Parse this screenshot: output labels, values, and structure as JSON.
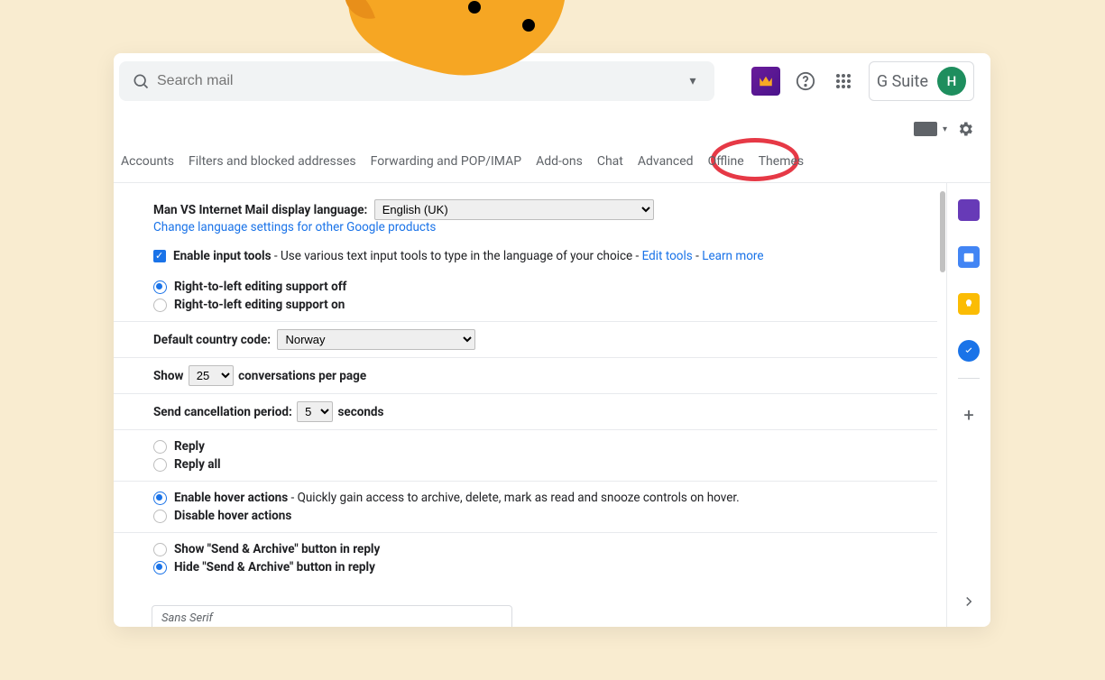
{
  "header": {
    "search_placeholder": "Search mail",
    "gsuite_label": "G Suite",
    "avatar_initial": "H"
  },
  "tabs": [
    "Accounts",
    "Filters and blocked addresses",
    "Forwarding and POP/IMAP",
    "Add-ons",
    "Chat",
    "Advanced",
    "Offline",
    "Themes"
  ],
  "annotation": {
    "circled_tab": "Offline"
  },
  "settings": {
    "language": {
      "label": "Man VS Internet Mail display language:",
      "value": "English (UK)",
      "change_link": "Change language settings for other Google products"
    },
    "input_tools": {
      "label": "Enable input tools",
      "desc": " - Use various text input tools to type in the language of your choice - ",
      "edit_link": "Edit tools",
      "sep": " - ",
      "learn_link": "Learn more"
    },
    "rtl": {
      "off": "Right-to-left editing support off",
      "on": "Right-to-left editing support on"
    },
    "country_code": {
      "label": "Default country code:",
      "value": "Norway"
    },
    "page_size": {
      "prefix": "Show",
      "value": "25",
      "suffix": "conversations per page"
    },
    "undo_send": {
      "label": "Send cancellation period:",
      "value": "5",
      "suffix": "seconds"
    },
    "default_reply": {
      "reply": "Reply",
      "reply_all": "Reply all"
    },
    "hover": {
      "enable": "Enable hover actions",
      "enable_desc": " - Quickly gain access to archive, delete, mark as read and snooze controls on hover.",
      "disable": "Disable hover actions"
    },
    "send_archive": {
      "show": "Show \"Send & Archive\" button in reply",
      "hide": "Hide \"Send & Archive\" button in reply"
    }
  },
  "bottom_strip": {
    "font_label": "Sans Serif"
  }
}
